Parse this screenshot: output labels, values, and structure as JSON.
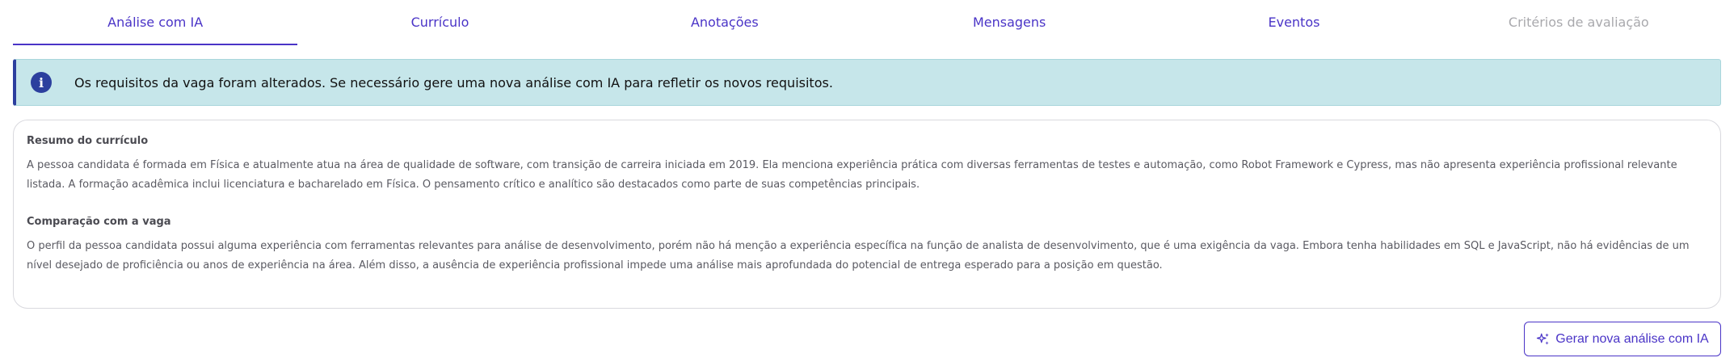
{
  "tabs": [
    {
      "label": "Análise com IA",
      "state": "active"
    },
    {
      "label": "Currículo",
      "state": "normal"
    },
    {
      "label": "Anotações",
      "state": "normal"
    },
    {
      "label": "Mensagens",
      "state": "normal"
    },
    {
      "label": "Eventos",
      "state": "normal"
    },
    {
      "label": "Critérios de avaliação",
      "state": "disabled"
    }
  ],
  "alert": {
    "icon": "info-icon",
    "text": "Os requisitos da vaga foram alterados. Se necessário gere uma nova análise com IA para refletir os novos requisitos."
  },
  "analysis": {
    "summary_title": "Resumo do currículo",
    "summary_body": "A pessoa candidata é formada em Física e atualmente atua na área de qualidade de software, com transição de carreira iniciada em 2019. Ela menciona experiência prática com diversas ferramentas de testes e automação, como Robot Framework e Cypress, mas não apresenta experiência profissional relevante listada. A formação acadêmica inclui licenciatura e bacharelado em Física. O pensamento crítico e analítico são destacados como parte de suas competências principais.",
    "comparison_title": "Comparação com a vaga",
    "comparison_body": "O perfil da pessoa candidata possui alguma experiência com ferramentas relevantes para análise de desenvolvimento, porém não há menção a experiência específica na função de analista de desenvolvimento, que é uma exigência da vaga. Embora tenha habilidades em SQL e JavaScript, não há evidências de um nível desejado de proficiência ou anos de experiência na área. Além disso, a ausência de experiência profissional impede uma análise mais aprofundada do potencial de entrega esperado para a posição em questão."
  },
  "actions": {
    "generate_icon": "sparkles-icon",
    "generate_label": "Gerar nova análise com IA"
  },
  "colors": {
    "accent": "#4a34c7",
    "alert_bg": "#c6e6ea",
    "alert_border": "#2c3f9e",
    "disabled": "#a9a9ad"
  }
}
